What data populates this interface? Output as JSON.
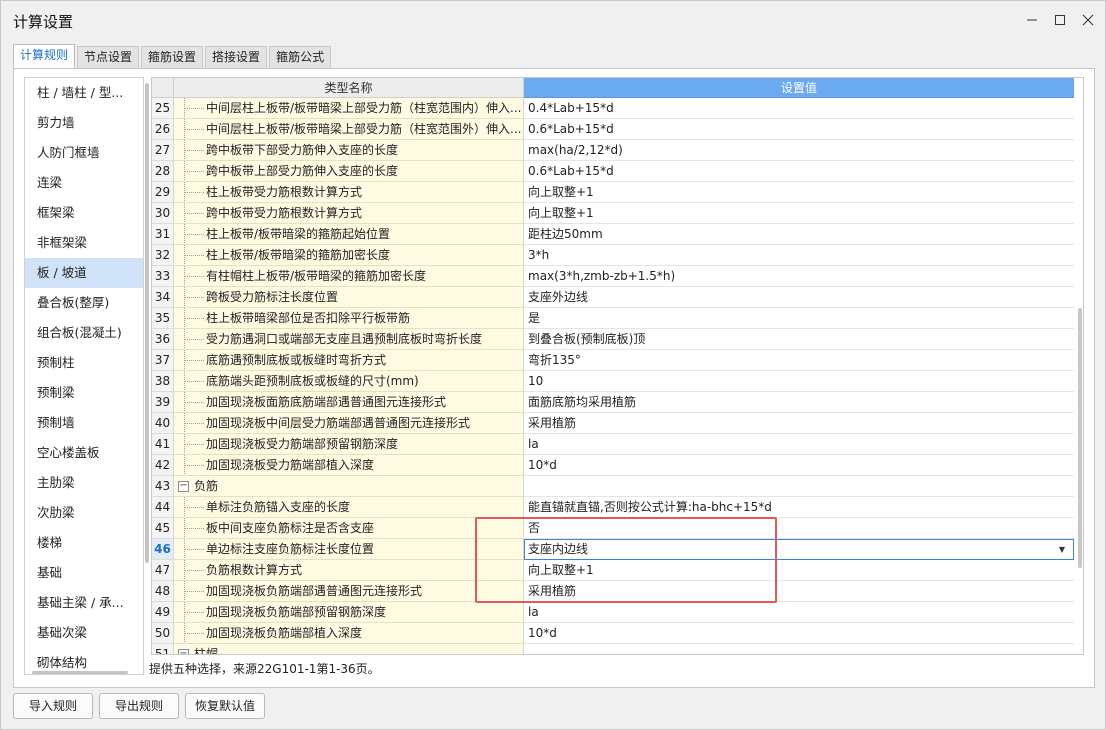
{
  "window": {
    "title": "计算设置"
  },
  "tabs": [
    {
      "label": "计算规则",
      "active": true
    },
    {
      "label": "节点设置"
    },
    {
      "label": "箍筋设置"
    },
    {
      "label": "搭接设置"
    },
    {
      "label": "箍筋公式"
    }
  ],
  "sidebar": {
    "items": [
      "柱 / 墙柱 / 型...",
      "剪力墙",
      "人防门框墙",
      "连梁",
      "框架梁",
      "非框架梁",
      "板 / 坡道",
      "叠合板(整厚)",
      "组合板(混凝土)",
      "预制柱",
      "预制梁",
      "预制墙",
      "空心楼盖板",
      "主肋梁",
      "次肋梁",
      "楼梯",
      "基础",
      "基础主梁 / 承...",
      "基础次梁",
      "砌体结构"
    ],
    "selected": "板 / 坡道"
  },
  "grid": {
    "header_name": "类型名称",
    "header_value": "设置值",
    "rows": [
      {
        "idx": "25",
        "name": "中间层柱上板带/板带暗梁上部受力筋（柱宽范围内）伸入...",
        "value": "0.4*Lab+15*d"
      },
      {
        "idx": "26",
        "name": "中间层柱上板带/板带暗梁上部受力筋（柱宽范围外）伸入...",
        "value": "0.6*Lab+15*d"
      },
      {
        "idx": "27",
        "name": "跨中板带下部受力筋伸入支座的长度",
        "value": "max(ha/2,12*d)"
      },
      {
        "idx": "28",
        "name": "跨中板带上部受力筋伸入支座的长度",
        "value": "0.6*Lab+15*d"
      },
      {
        "idx": "29",
        "name": "柱上板带受力筋根数计算方式",
        "value": "向上取整+1"
      },
      {
        "idx": "30",
        "name": "跨中板带受力筋根数计算方式",
        "value": "向上取整+1"
      },
      {
        "idx": "31",
        "name": "柱上板带/板带暗梁的箍筋起始位置",
        "value": "距柱边50mm"
      },
      {
        "idx": "32",
        "name": "柱上板带/板带暗梁的箍筋加密长度",
        "value": "3*h"
      },
      {
        "idx": "33",
        "name": "有柱帽柱上板带/板带暗梁的箍筋加密长度",
        "value": "max(3*h,zmb-zb+1.5*h)"
      },
      {
        "idx": "34",
        "name": "跨板受力筋标注长度位置",
        "value": "支座外边线"
      },
      {
        "idx": "35",
        "name": "柱上板带暗梁部位是否扣除平行板带筋",
        "value": "是"
      },
      {
        "idx": "36",
        "name": "受力筋遇洞口或端部无支座且遇预制底板时弯折长度",
        "value": "到叠合板(预制底板)顶"
      },
      {
        "idx": "37",
        "name": "底筋遇预制底板或板缝时弯折方式",
        "value": "弯折135°"
      },
      {
        "idx": "38",
        "name": "底筋端头距预制底板或板缝的尺寸(mm)",
        "value": "10"
      },
      {
        "idx": "39",
        "name": "加固现浇板面筋底筋端部遇普通图元连接形式",
        "value": "面筋底筋均采用植筋"
      },
      {
        "idx": "40",
        "name": "加固现浇板中间层受力筋端部遇普通图元连接形式",
        "value": "采用植筋"
      },
      {
        "idx": "41",
        "name": "加固现浇板受力筋端部预留钢筋深度",
        "value": "la"
      },
      {
        "idx": "42",
        "name": "加固现浇板受力筋端部植入深度",
        "value": "10*d"
      },
      {
        "idx": "43",
        "name": "负筋",
        "value": "",
        "group": true,
        "expander": "−"
      },
      {
        "idx": "44",
        "name": "单标注负筋锚入支座的长度",
        "value": "能直锚就直锚,否则按公式计算:ha-bhc+15*d"
      },
      {
        "idx": "45",
        "name": "板中间支座负筋标注是否含支座",
        "value": "否"
      },
      {
        "idx": "46",
        "name": "单边标注支座负筋标注长度位置",
        "value": "支座内边线",
        "current": true
      },
      {
        "idx": "47",
        "name": "负筋根数计算方式",
        "value": "向上取整+1"
      },
      {
        "idx": "48",
        "name": "加固现浇板负筋端部遇普通图元连接形式",
        "value": "采用植筋"
      },
      {
        "idx": "49",
        "name": "加固现浇板负筋端部预留钢筋深度",
        "value": "la"
      },
      {
        "idx": "50",
        "name": "加固现浇板负筋端部植入深度",
        "value": "10*d"
      },
      {
        "idx": "51",
        "name": "柱帽",
        "value": "",
        "group": true,
        "expander": "−"
      }
    ]
  },
  "status_text": "提供五种选择，来源22G101-1第1-36页。",
  "buttons": {
    "import": "导入规则",
    "export": "导出规则",
    "restore": "恢复默认值"
  },
  "colors": {
    "accent": "#1e6fc8",
    "header_value_bg": "#6baaf0",
    "name_cell_bg": "#fffbe3",
    "highlight": "#e05a5a"
  }
}
